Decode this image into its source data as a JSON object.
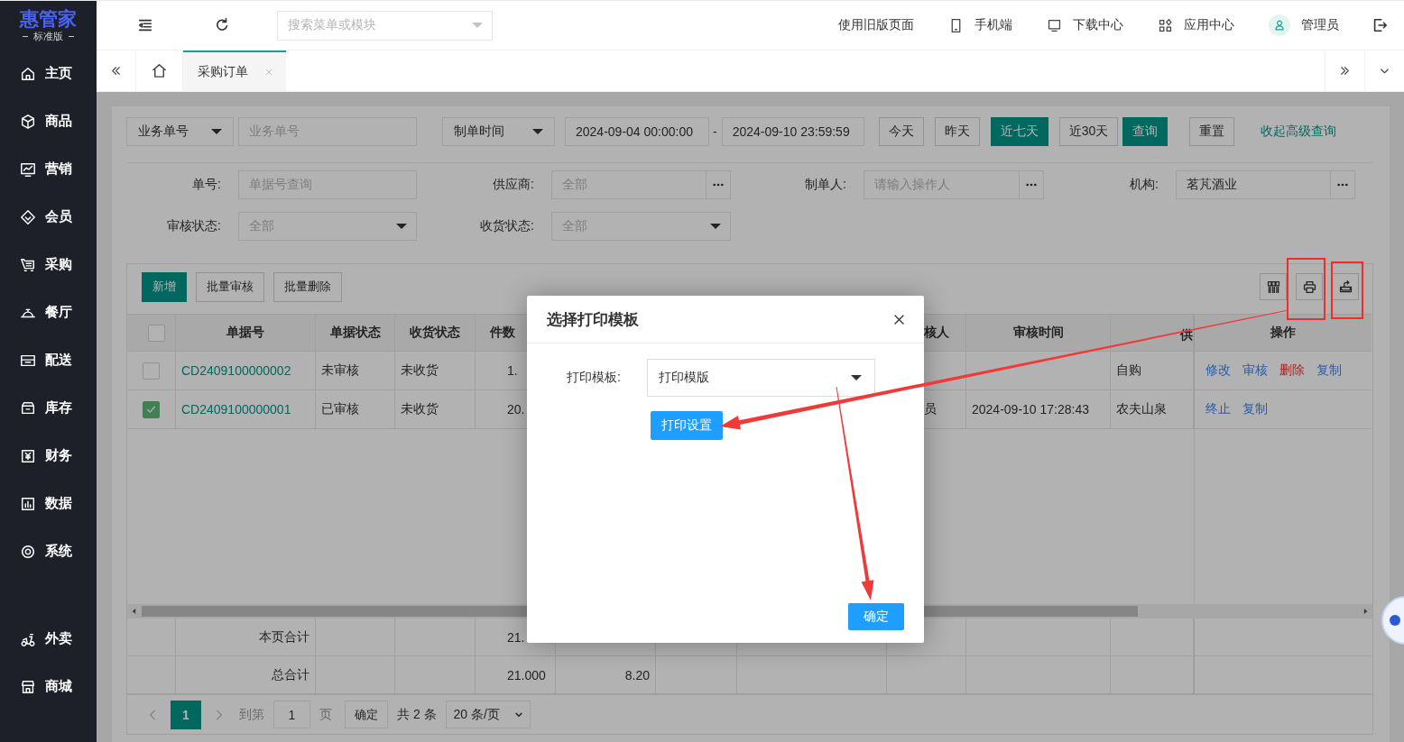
{
  "brand": {
    "name": "惠管家",
    "edition": "标准版"
  },
  "sidebar": {
    "items": [
      {
        "label": "主页"
      },
      {
        "label": "商品"
      },
      {
        "label": "营销"
      },
      {
        "label": "会员"
      },
      {
        "label": "采购"
      },
      {
        "label": "餐厅"
      },
      {
        "label": "配送"
      },
      {
        "label": "库存"
      },
      {
        "label": "财务"
      },
      {
        "label": "数据"
      },
      {
        "label": "系统"
      }
    ],
    "bottom_items": [
      {
        "label": "外卖"
      },
      {
        "label": "商城"
      }
    ]
  },
  "header": {
    "search": {
      "placeholder": "搜索菜单或模块"
    },
    "links": [
      {
        "label": "使用旧版页面"
      },
      {
        "label": "手机端"
      },
      {
        "label": "下载中心"
      },
      {
        "label": "应用中心"
      }
    ],
    "user": "管理员"
  },
  "tabs": [
    {
      "label": "采购订单",
      "selected": true
    }
  ],
  "filters": {
    "key_select": "业务单号",
    "key_input": {
      "placeholder": "业务单号"
    },
    "date_select": "制单时间",
    "date_start": "2024-09-04 00:00:00",
    "date_separator": "-",
    "date_end": "2024-09-10 23:59:59",
    "ranges": [
      {
        "label": "今天",
        "selected": false
      },
      {
        "label": "昨天",
        "selected": false
      },
      {
        "label": "近七天",
        "selected": true
      },
      {
        "label": "近30天",
        "selected": false
      }
    ],
    "search_button": "查询",
    "reset_button": "重置",
    "toggle_link": "收起高级查询",
    "fields": [
      {
        "label": "单号:",
        "placeholder": "单据号查询",
        "kind": "input"
      },
      {
        "label": "供应商:",
        "placeholder": "全部",
        "kind": "picker"
      },
      {
        "label": "制单人:",
        "placeholder": "请输入操作人",
        "kind": "picker"
      },
      {
        "label": "机构:",
        "value": "茗芃酒业",
        "kind": "picker"
      },
      {
        "label": "审核状态:",
        "placeholder": "全部",
        "kind": "select"
      },
      {
        "label": "收货状态:",
        "placeholder": "全部",
        "kind": "select"
      }
    ]
  },
  "toolbar": {
    "buttons": [
      {
        "label": "新增",
        "kind": "primary"
      },
      {
        "label": "批量审核",
        "kind": "default"
      },
      {
        "label": "批量删除",
        "kind": "default"
      }
    ]
  },
  "table": {
    "select_all": {
      "checked": false
    },
    "columns": [
      "单据号",
      "单据状态",
      "收货状态",
      "件数",
      "核人",
      "审核时间",
      "供",
      "操作"
    ],
    "rows": [
      {
        "checked": false,
        "order_no": "CD2409100000002",
        "doc_status": "未审核",
        "receipt_status": "未收货",
        "qty": "1.",
        "supplier": "自购",
        "actions": [
          {
            "label": "修改",
            "kind": "link"
          },
          {
            "label": "审核",
            "kind": "link"
          },
          {
            "label": "删除",
            "kind": "danger"
          },
          {
            "label": "复制",
            "kind": "link"
          }
        ]
      },
      {
        "checked": true,
        "order_no": "CD2409100000001",
        "doc_status": "已审核",
        "receipt_status": "未收货",
        "qty": "20.",
        "reviewer": "员",
        "review_time": "2024-09-10 17:28:43",
        "supplier": "农夫山泉",
        "actions": [
          {
            "label": "终止",
            "kind": "link"
          },
          {
            "label": "复制",
            "kind": "link"
          }
        ]
      }
    ],
    "totals": [
      {
        "label": "本页合计",
        "qty": "21."
      },
      {
        "label": "总合计",
        "qty": "21.000",
        "column_6": "8.20"
      }
    ]
  },
  "pagination": {
    "pages": [
      {
        "label": "1",
        "selected": true
      }
    ],
    "goto_label": "到第",
    "goto_value": "1",
    "page_unit": "页",
    "goto_button": "确定",
    "total": "共 2 条",
    "page_size": "20 条/页"
  },
  "dialog": {
    "title": "选择打印模板",
    "field_label": "打印模板:",
    "template": "打印模版",
    "settings_button": "打印设置",
    "confirm_button": "确定"
  }
}
